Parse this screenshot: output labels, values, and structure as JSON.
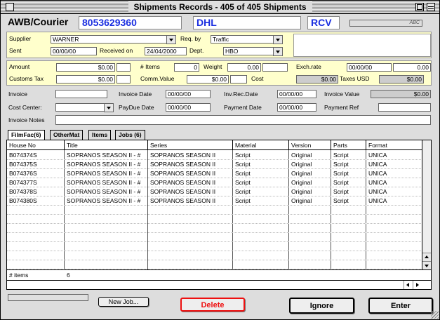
{
  "window": {
    "title": "Shipments Records - 405 of 405 Shipments"
  },
  "header": {
    "label": "AWB/Courier",
    "awb": "8053629360",
    "courier": "DHL",
    "status": "RCV",
    "indicator": "ABC"
  },
  "shipment": {
    "supplier_label": "Supplier",
    "supplier": "WARNER",
    "reqby_label": "Req. by",
    "reqby": "Traffic",
    "sent_label": "Sent",
    "sent": "00/00/00",
    "received_label": "Received on",
    "received": "24/04/2000",
    "dept_label": "Dept.",
    "dept": "HBO"
  },
  "costs": {
    "amount_label": "Amount",
    "amount": "$0.00",
    "items_label": "# Items",
    "items": "0",
    "weight_label": "Weight",
    "weight": "0.00",
    "exchrate_label": "Exch.rate",
    "exchrate_date": "00/00/00",
    "exchrate": "0.00",
    "customs_label": "Customs Tax",
    "customs": "$0.00",
    "comm_label": "Comm.Value",
    "comm": "$0.00",
    "cost_label": "Cost",
    "cost": "$0.00",
    "taxes_label": "Taxes USD",
    "taxes": "$0.00"
  },
  "invoice": {
    "invoice_label": "Invoice",
    "invoice": "",
    "invdate_label": "Invoice Date",
    "invdate": "00/00/00",
    "invrec_label": "Inv.Rec.Date",
    "invrec": "00/00/00",
    "invvalue_label": "Invoice Value",
    "invvalue": "$0.00",
    "costcenter_label": "Cost Center:",
    "costcenter": "",
    "paydue_label": "PayDue Date",
    "paydue": "00/00/00",
    "paydate_label": "Payment Date",
    "paydate": "00/00/00",
    "payref_label": "Payment Ref",
    "payref": "",
    "notes_label": "Invoice Notes",
    "notes": ""
  },
  "tabs": [
    {
      "label": "FilmFac(6)"
    },
    {
      "label": "OtherMat"
    },
    {
      "label": "Items"
    },
    {
      "label": "Jobs (6)"
    }
  ],
  "table": {
    "columns": [
      "House No",
      "Title",
      "Series",
      "Material",
      "Version",
      "Parts",
      "Format"
    ],
    "rows": [
      [
        "B074374S",
        "SOPRANOS SEASON II - #",
        "SOPRANOS SEASON II",
        "Script",
        "Original",
        "Script",
        "UNICA"
      ],
      [
        "B074375S",
        "SOPRANOS SEASON II - #",
        "SOPRANOS SEASON II",
        "Script",
        "Original",
        "Script",
        "UNICA"
      ],
      [
        "B074376S",
        "SOPRANOS SEASON II - #",
        "SOPRANOS SEASON II",
        "Script",
        "Original",
        "Script",
        "UNICA"
      ],
      [
        "B074377S",
        "SOPRANOS SEASON II - #",
        "SOPRANOS SEASON II",
        "Script",
        "Original",
        "Script",
        "UNICA"
      ],
      [
        "B074378S",
        "SOPRANOS SEASON II - #",
        "SOPRANOS SEASON II",
        "Script",
        "Original",
        "Script",
        "UNICA"
      ],
      [
        "B074380S",
        "SOPRANOS SEASON II - #",
        "SOPRANOS SEASON II",
        "Script",
        "Original",
        "Script",
        "UNICA"
      ]
    ],
    "footer_label": "# items",
    "footer_count": "6"
  },
  "buttons": {
    "new_job": "New Job...",
    "delete": "Delete",
    "ignore": "Ignore",
    "enter": "Enter"
  },
  "colors": {
    "panel_bg": "#ffffcc",
    "header_text": "#1a2ee0",
    "delete_red": "#ee1010"
  }
}
